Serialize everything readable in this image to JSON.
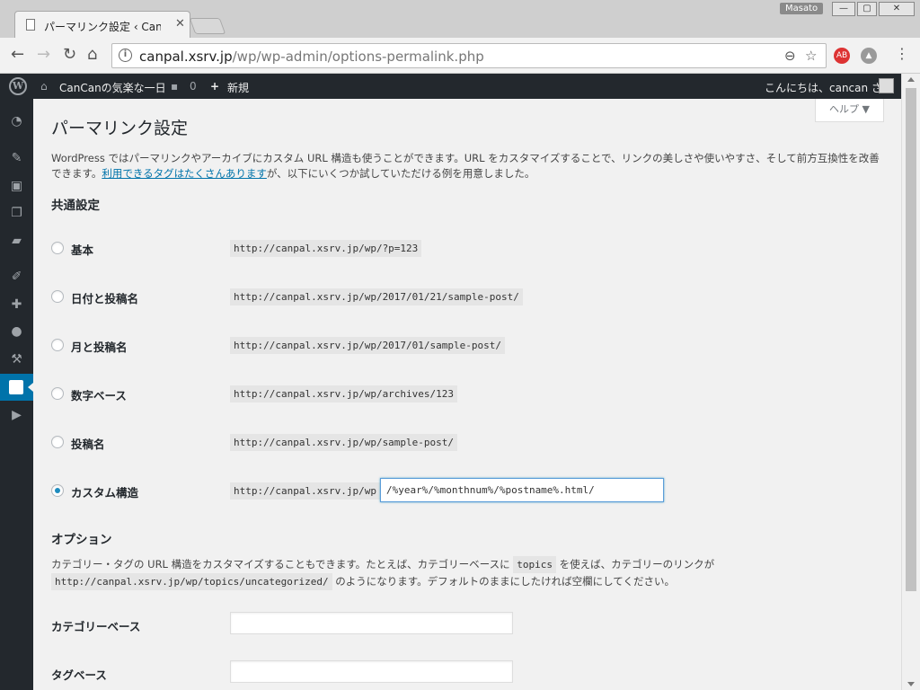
{
  "browser": {
    "tab_title": "パーマリンク設定 ‹ CanC",
    "profile_name": "Masato",
    "url_host": "canpal.xsrv.jp",
    "url_path": "/wp/wp-admin/options-permalink.php"
  },
  "admin_bar": {
    "site_name": "CanCanの気楽な一日",
    "comments_count": "0",
    "new_label": "新規",
    "greeting": "こんにちは、cancan さん"
  },
  "page": {
    "help_label": "ヘルプ ▼",
    "title": "パーマリンク設定",
    "intro_text": "WordPress ではパーマリンクやアーカイブにカスタム URL 構造も使うことができます。URL をカスタマイズすることで、リンクの美しさや使いやすさ、そして前方互換性を改善できます。",
    "intro_link": "利用できるタグはたくさんあります",
    "intro_tail": "が、以下にいくつか試していただける例を用意しました。",
    "common_heading": "共通設定",
    "options_heading": "オプション"
  },
  "permalink_options": [
    {
      "label": "基本",
      "example": "http://canpal.xsrv.jp/wp/?p=123",
      "checked": false
    },
    {
      "label": "日付と投稿名",
      "example": "http://canpal.xsrv.jp/wp/2017/01/21/sample-post/",
      "checked": false
    },
    {
      "label": "月と投稿名",
      "example": "http://canpal.xsrv.jp/wp/2017/01/sample-post/",
      "checked": false
    },
    {
      "label": "数字ベース",
      "example": "http://canpal.xsrv.jp/wp/archives/123",
      "checked": false
    },
    {
      "label": "投稿名",
      "example": "http://canpal.xsrv.jp/wp/sample-post/",
      "checked": false
    },
    {
      "label": "カスタム構造",
      "example": "http://canpal.xsrv.jp/wp",
      "checked": true,
      "value": "/%year%/%monthnum%/%postname%.html/"
    }
  ],
  "options": {
    "text_1": "カテゴリー・タグの URL 構造をカスタマイズすることもできます。たとえば、カテゴリーベースに",
    "code_1": "topics",
    "text_2": "を使えば、カテゴリーのリンクが",
    "code_2": "http://canpal.xsrv.jp/wp/topics/uncategorized/",
    "text_3": "のようになります。デフォルトのままにしたければ空欄にしてください。",
    "category_base_label": "カテゴリーベース",
    "category_base_value": "",
    "tag_base_label": "タグベース",
    "tag_base_value": ""
  },
  "sidebar_icons": [
    "dashboard-icon",
    "pin-icon",
    "media-icon",
    "pages-icon",
    "comments-icon",
    "appearance-icon",
    "plugins-icon",
    "users-icon",
    "tools-icon",
    "settings-icon",
    "play-icon"
  ],
  "colors": {
    "accent": "#0073aa",
    "admin_bar": "#23282d",
    "background": "#f1f1f1"
  }
}
